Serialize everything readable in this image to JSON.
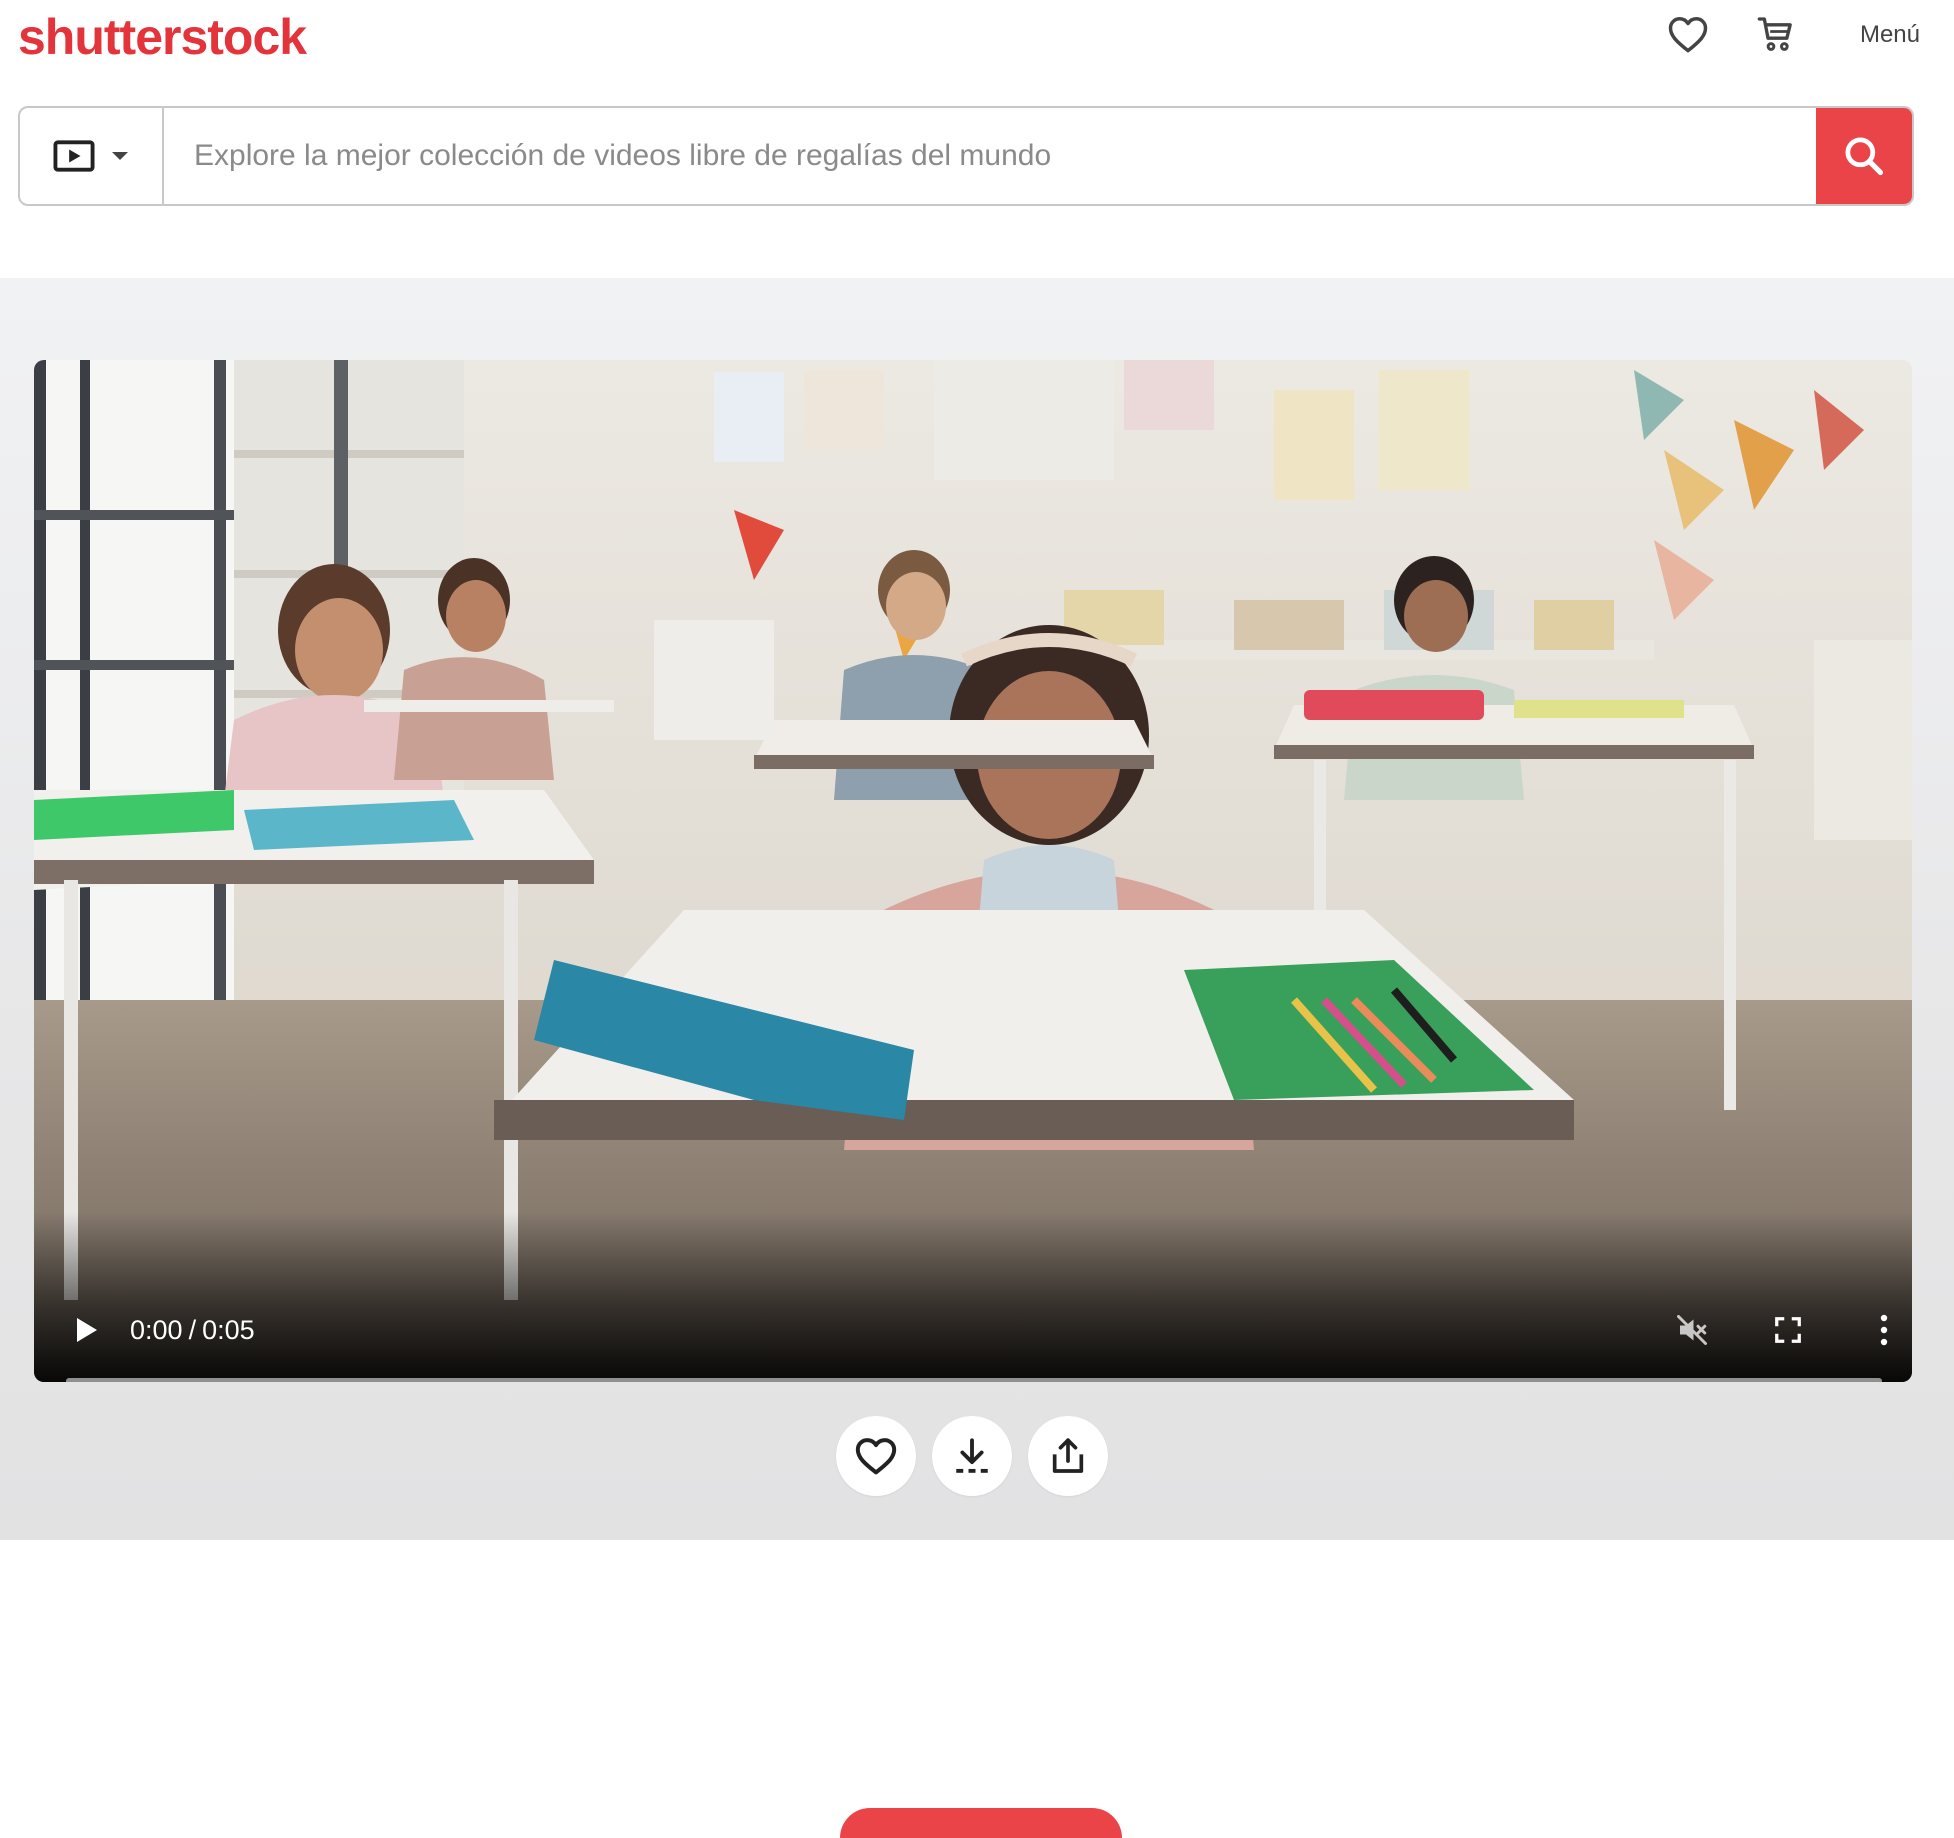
{
  "brand": {
    "logo_text": "shutterstock",
    "accent_color": "#e3333b",
    "search_button_color": "#ea4448"
  },
  "header": {
    "favorites_icon": "heart-outline-icon",
    "cart_icon": "shopping-cart-icon",
    "menu_label": "Menú"
  },
  "search": {
    "media_type_icon": "video-play-icon",
    "media_type_dropdown_icon": "caret-down-icon",
    "placeholder": "Explore la mejor colección de videos libre de regalías del mundo",
    "value": "",
    "submit_icon": "search-icon"
  },
  "player": {
    "current_time": "0:00",
    "time_separator": "/",
    "duration": "0:05",
    "progress": 0,
    "play_icon": "play-icon",
    "mute_icon": "volume-muted-icon",
    "fullscreen_icon": "fullscreen-icon",
    "more_icon": "more-vertical-icon"
  },
  "actions": [
    {
      "name": "favorite",
      "icon": "heart-outline-icon"
    },
    {
      "name": "download",
      "icon": "download-icon"
    },
    {
      "name": "share",
      "icon": "share-icon"
    }
  ]
}
